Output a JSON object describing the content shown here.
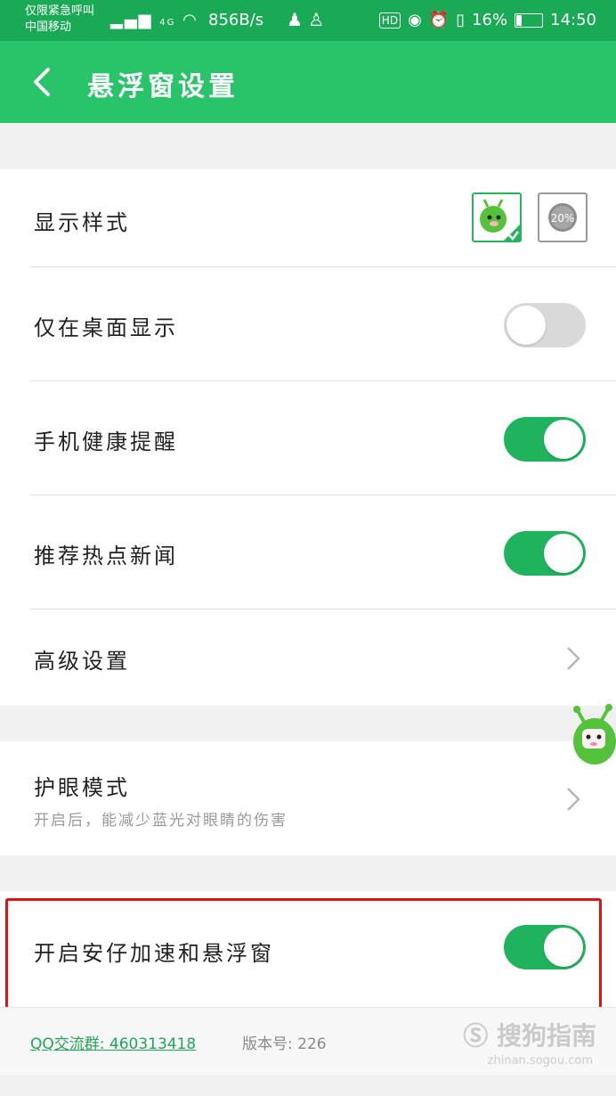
{
  "status_bar": {
    "carrier_line1": "仅限紧急呼叫",
    "carrier_line2": "中国移动",
    "network": "4G",
    "speed": "856B/s",
    "hd": "HD",
    "battery": "16%",
    "time": "14:50"
  },
  "app_bar": {
    "title": "悬浮窗设置"
  },
  "settings": {
    "display_style": {
      "label": "显示样式",
      "option_2_text": "20%"
    },
    "desktop_only": {
      "label": "仅在桌面显示",
      "enabled": false
    },
    "health_reminder": {
      "label": "手机健康提醒",
      "enabled": true
    },
    "hot_news": {
      "label": "推荐热点新闻",
      "enabled": true
    },
    "advanced": {
      "label": "高级设置"
    },
    "eye_care": {
      "label": "护眼模式",
      "subtitle": "开启后，能减少蓝光对眼睛的伤害"
    },
    "enable_float": {
      "label": "开启安仔加速和悬浮窗",
      "enabled": true
    }
  },
  "footer": {
    "qq_group": "QQ交流群: 460313418",
    "version": "版本号: 226",
    "watermark": "搜狗指南",
    "watermark_url": "zhinan.sogou.com"
  },
  "colors": {
    "status_bar": "#1aaa55",
    "app_bar": "#29c369",
    "toggle_on": "#20b35e",
    "highlight_border": "#e01212"
  }
}
